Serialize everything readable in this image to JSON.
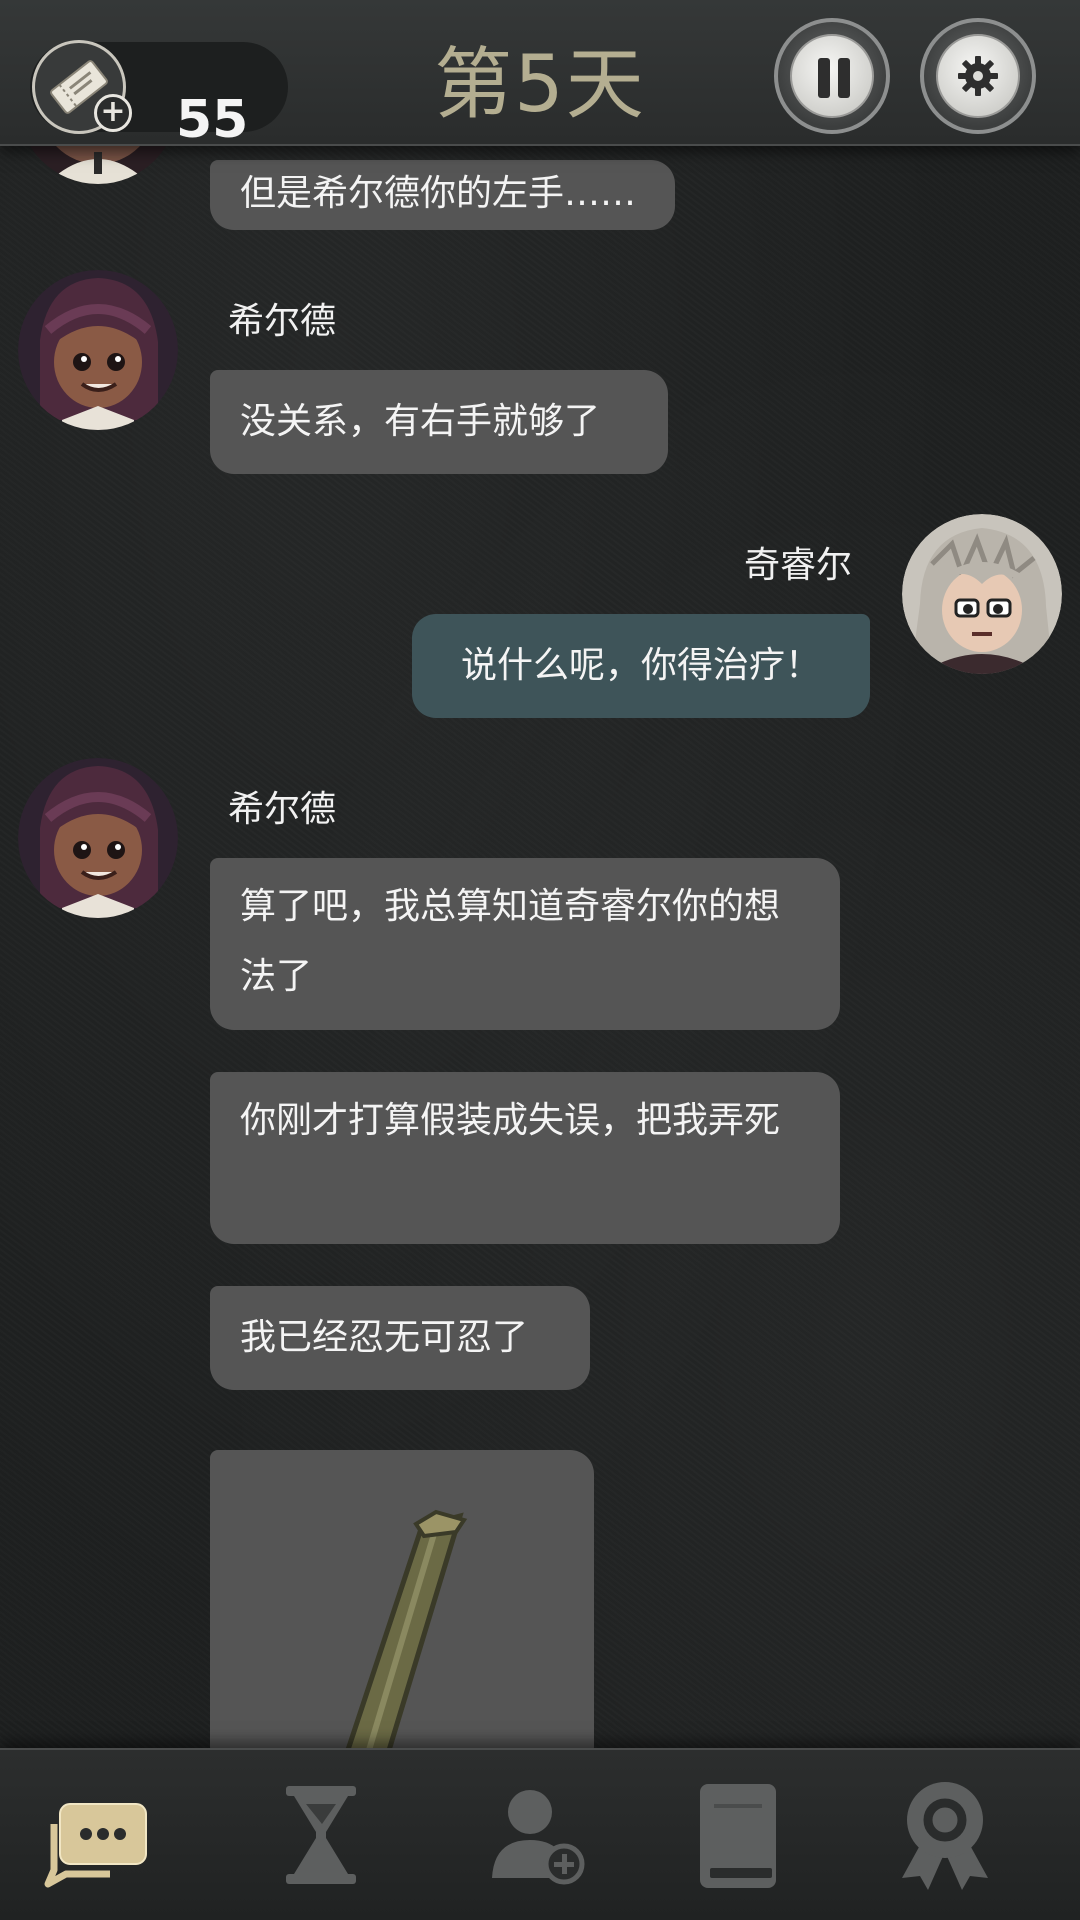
{
  "header": {
    "ticket_count": "55",
    "day_title": "第5天"
  },
  "messages": [
    {
      "speaker": "",
      "text": "但是希尔德你的左手……"
    },
    {
      "speaker": "希尔德",
      "text": "没关系，有右手就够了"
    },
    {
      "speaker": "奇睿尔",
      "text": "说什么呢，你得治疗！"
    },
    {
      "speaker": "希尔德",
      "text": "算了吧，我总算知道奇睿尔你的想法了"
    },
    {
      "speaker": "",
      "text": "你刚才打算假装成失误，把我弄死"
    },
    {
      "speaker": "",
      "text": "我已经忍无可忍了"
    }
  ],
  "icons": {
    "ticket": "ticket-icon",
    "add": "plus-icon",
    "pause": "pause-icon",
    "settings": "gear-icon",
    "nav_chat": "chat-bubbles-icon",
    "nav_time": "hourglass-icon",
    "nav_contacts": "add-contact-icon",
    "nav_journal": "book-icon",
    "nav_achievements": "award-ribbon-icon"
  },
  "colors": {
    "accent_gold": "#b4ae91",
    "active_nav": "#d8c79a",
    "inactive_nav": "#5d5f5f",
    "bubble_left": "#555555",
    "bubble_right": "#3e5459"
  }
}
